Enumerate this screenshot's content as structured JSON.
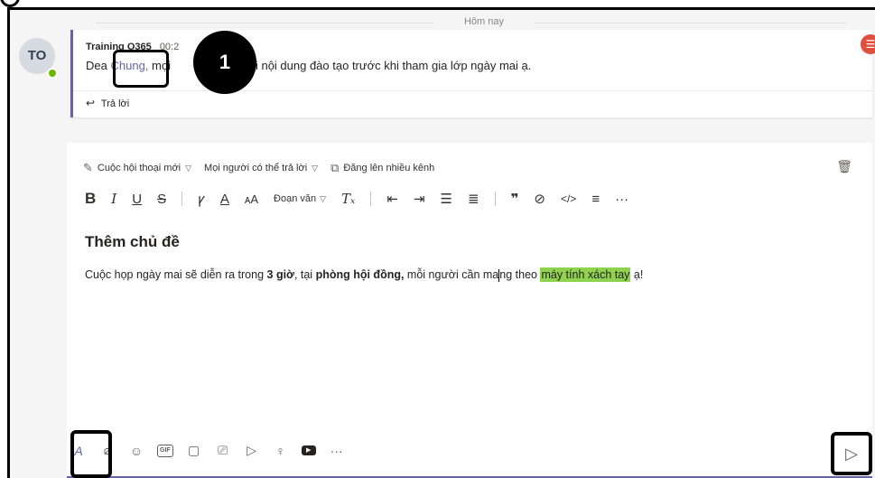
{
  "date_divider": "Hôm nay",
  "message": {
    "avatar_initials": "TO",
    "author": "Training O365",
    "time": "00:2",
    "greeting_prefix": "Dea",
    "mention": "Chung,",
    "body_fragment_1": "mọi",
    "body_fragment_2": "ck lại nội dung đào tạo trước khi tham gia lớp ngày mai ạ.",
    "reply_label": "Trả lời"
  },
  "annotation": {
    "step_number": "1"
  },
  "compose": {
    "toolbar": {
      "new_conversation": "Cuộc hội thoại mới",
      "reply_permission": "Mọi người có thể trả lời",
      "post_multiple": "Đăng lên nhiều kênh"
    },
    "format": {
      "bold": "B",
      "italic": "I",
      "underline": "U",
      "strike": "S",
      "highlight": "ꝩ",
      "font_color": "A",
      "font_size": "ᴀA",
      "paragraph": "Đoạn văn",
      "clear": "Tₓ",
      "more": "···"
    },
    "subject": "Thêm chủ đề",
    "body": {
      "part1": "Cuộc họp ngày mai sẽ diễn ra trong ",
      "bold1": "3 giờ",
      "part2": ", tại ",
      "bold2": "phòng hội đồng,",
      "part3": " mỗi người cần ma",
      "part4": "ng theo ",
      "highlighted": "máy tính xách tay",
      "part5": " ạ!"
    },
    "bottom_more": "···"
  },
  "colors": {
    "accent": "#6264a7",
    "highlight": "#8fd24f",
    "presence_available": "#6bb700"
  },
  "icons": {
    "format": "format-icon",
    "attach": "paperclip-icon",
    "emoji": "emoji-icon",
    "gif": "gif-icon",
    "sticker": "sticker-icon",
    "meet": "meet-now-icon",
    "praise": "praise-icon",
    "send": "send-icon",
    "trash": "trash-icon"
  }
}
